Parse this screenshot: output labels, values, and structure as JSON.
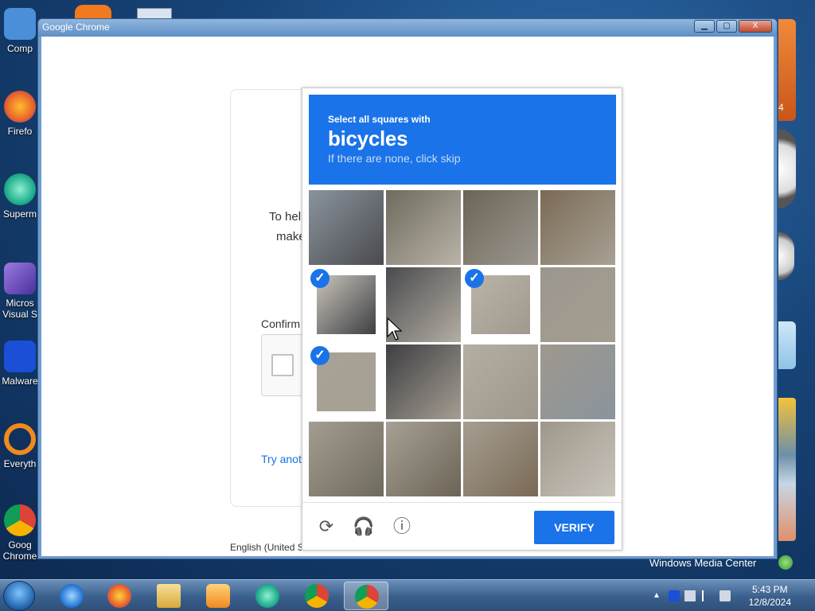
{
  "desktop": {
    "icons": [
      {
        "label": "Comp",
        "color": "#4a8fd8"
      },
      {
        "label": "Firefo",
        "color": "#e8632b"
      },
      {
        "label": "Superm",
        "color": "#23b08f"
      },
      {
        "label": "Micros Visual S",
        "color": "#6b4fbf"
      },
      {
        "label": "Malware",
        "color": "#1a4fd6"
      },
      {
        "label": "Everyth",
        "color": "#f08a1d"
      },
      {
        "label": "Goog Chrome",
        "color": "#dd4b39"
      }
    ],
    "media_center_label": "Windows Media Center",
    "gadget_digit": "4"
  },
  "window": {
    "title": "Google Chrome",
    "min_label": "▁",
    "max_label": "▢",
    "close_label": "X"
  },
  "page": {
    "line1": "To hel",
    "line2": "make",
    "confirm": "Confirm",
    "try_another": "Try anot",
    "language": "English (United S"
  },
  "captcha": {
    "instruction": "Select all squares with",
    "target": "bicycles",
    "hint": "If there are none, click skip",
    "selected": [
      4,
      6,
      8
    ],
    "check_glyph": "✓",
    "reload_icon": "⟳",
    "audio_icon": "🎧",
    "info_icon": "ⓘ",
    "verify_label": "VERIFY",
    "accent": "#1a73e8"
  },
  "taskbar": {
    "time": "5:43 PM",
    "date": "12/8/2024"
  }
}
